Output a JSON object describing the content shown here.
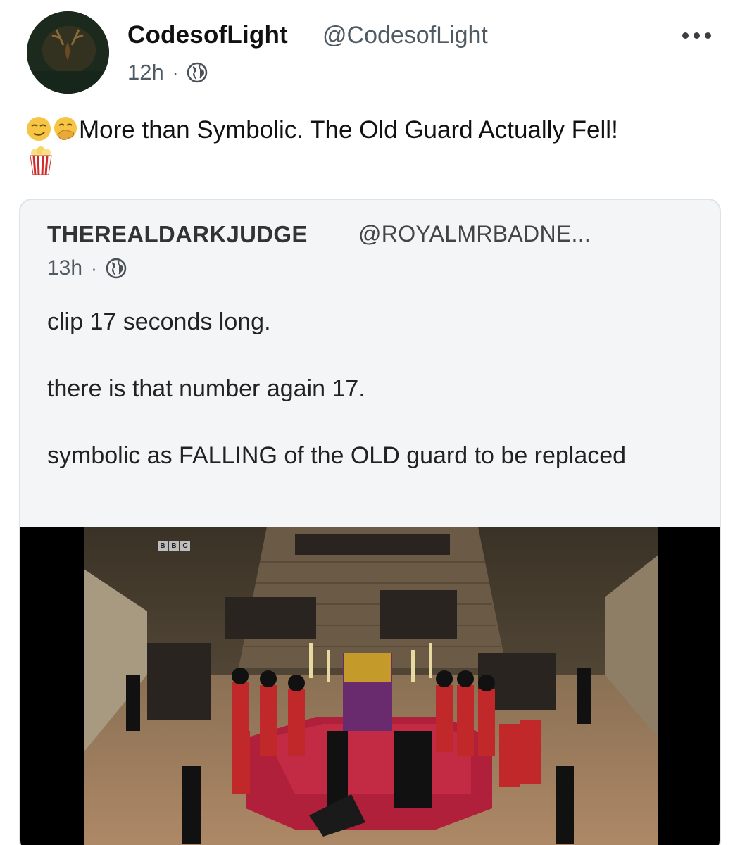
{
  "post": {
    "author_name": "CodesofLight",
    "author_handle": "@CodesofLight",
    "time": "12h",
    "separator": "·",
    "text": "More than Symbolic. The Old Guard Actually Fell!",
    "leading_icons": [
      "smirking-face-icon",
      "face-with-hand-over-mouth-icon"
    ],
    "trailing_icon": "popcorn-icon",
    "visibility_icon": "globe-icon",
    "menu_icon": "more-options-icon"
  },
  "quoted_post": {
    "author_name": "THEREALDARKJUDGE",
    "author_handle": "@ROYALMRBADNE...",
    "time": "13h",
    "separator": "·",
    "visibility_icon": "globe-icon",
    "paragraphs": [
      "clip 17 seconds long.",
      "there is that number again 17.",
      "symbolic as FALLING of the OLD guard to be replaced"
    ],
    "media": {
      "type": "video-frame",
      "broadcaster_logo": [
        "B",
        "B",
        "C"
      ]
    }
  },
  "colors": {
    "name": "#111111",
    "secondary": "#505a63",
    "quote_background": "#f4f5f7",
    "quote_border": "#dfe3e7",
    "carpet": "#b0203a",
    "uniform_red": "#c0282a"
  }
}
